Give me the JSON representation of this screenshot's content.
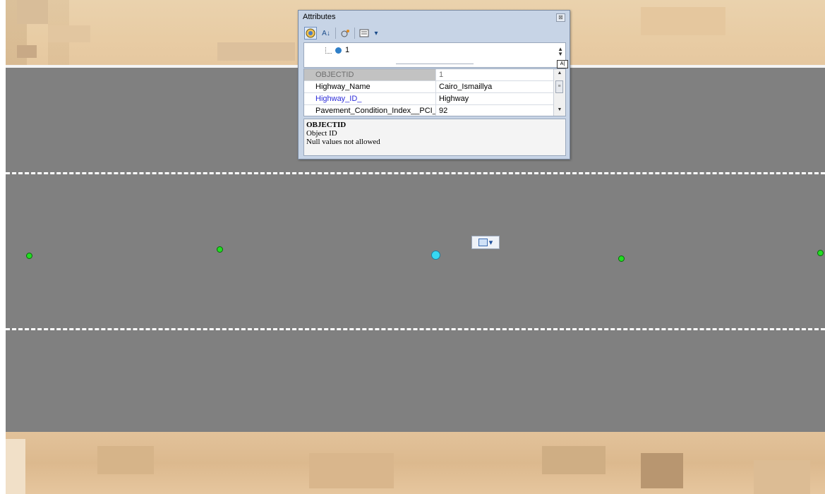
{
  "attributes_window": {
    "title": "Attributes",
    "close_glyph": "⊠",
    "toolbar": {
      "icons": [
        "list-by-layer-icon",
        "sort-az-icon",
        "identify-icon",
        "options-list-icon"
      ],
      "sort_glyph": "A↓",
      "dropdown_glyph": "▾"
    },
    "tree": {
      "feature_label": "1"
    },
    "fields": [
      {
        "name": "OBJECTID",
        "value": "1"
      },
      {
        "name": "Highway_Name",
        "value": "Cairo_Ismaillya"
      },
      {
        "name": "Highway_ID_",
        "value": "Highway"
      },
      {
        "name": "Pavement_Condition_Index__PCI_",
        "value": "92"
      }
    ],
    "description": {
      "field_title": "OBJECTID",
      "alias": "Object ID",
      "nullability": "Null values not allowed"
    },
    "view_toggle_glyph": "A|"
  },
  "map": {
    "road_color": "#808080",
    "lane_marking_color": "#ffffff",
    "vertex_color": "#22dd22",
    "selected_vertex_color": "#37d8f2",
    "mini_toolbar_dropdown_glyph": "▾"
  }
}
